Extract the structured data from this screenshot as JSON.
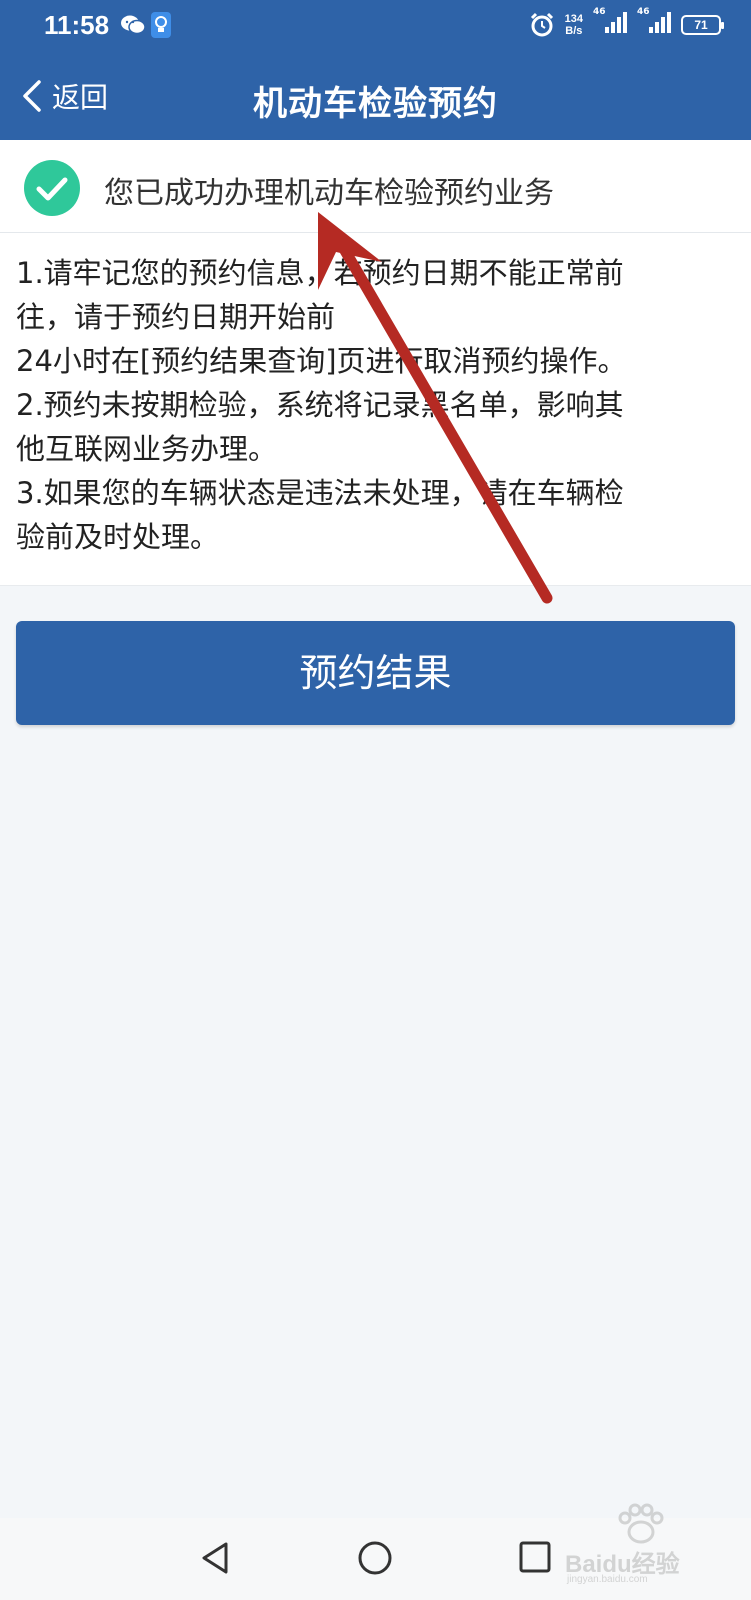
{
  "status_bar": {
    "time": "11:58",
    "net_speed_value": "134",
    "net_speed_unit": "B/s",
    "signal_1": "46",
    "signal_2": "46",
    "battery": "71"
  },
  "header": {
    "back_label": "返回",
    "title": "机动车检验预约"
  },
  "success": {
    "message": "您已成功办理机动车检验预约业务"
  },
  "notice": {
    "lines": [
      "1.请牢记您的预约信息，若预约日期不能正常前",
      "往，请于预约日期开始前",
      "24小时在[预约结果查询]页进行取消预约操作。",
      "2.预约未按期检验，系统将记录黑名单，影响其",
      "他互联网业务办理。",
      "3.如果您的车辆状态是违法未处理，请在车辆检",
      "验前及时处理。"
    ]
  },
  "actions": {
    "result_label": "预约结果"
  },
  "watermark": {
    "brand": "Baidu经验",
    "domain": "jingyan.baidu.com"
  },
  "colors": {
    "brand": "#2e63a8",
    "success_green": "#2fc89a",
    "annotation_arrow": "#b52a23",
    "page_bg": "#f3f6f9"
  }
}
